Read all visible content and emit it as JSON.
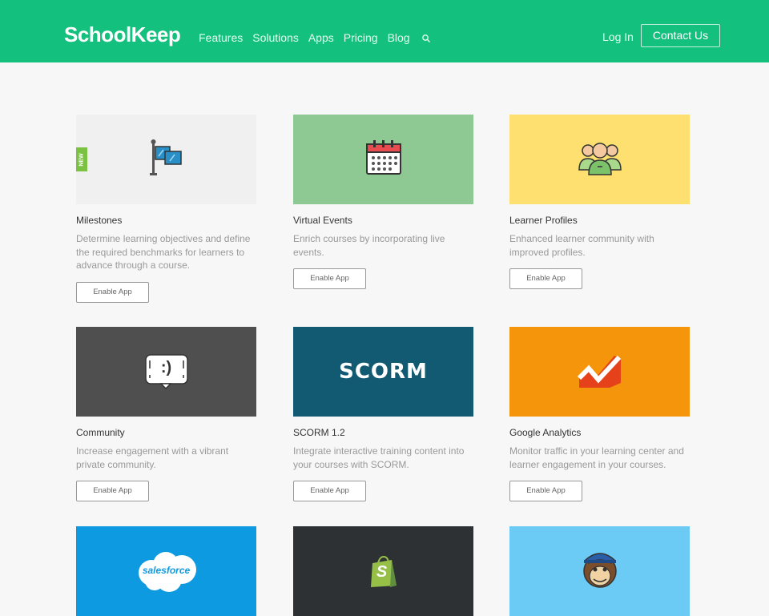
{
  "nav": {
    "logo": "SchoolKeep",
    "links": [
      "Features",
      "Solutions",
      "Apps",
      "Pricing",
      "Blog"
    ],
    "login": "Log In",
    "contact": "Contact Us"
  },
  "new_tag": "NEW",
  "cards": [
    {
      "title": "Milestones",
      "desc": "Determine learning objectives and define the required benchmarks for learners to advance through a course.",
      "button": "Enable App",
      "bg": "#f0f0f0",
      "icon": "flag-icon"
    },
    {
      "title": "Virtual Events",
      "desc": "Enrich courses by incorporating live events.",
      "button": "Enable App",
      "bg": "#8ec993",
      "icon": "calendar-icon"
    },
    {
      "title": "Learner Profiles",
      "desc": "Enhanced learner community with improved profiles.",
      "button": "Enable App",
      "bg": "#fde06f",
      "icon": "people-icon"
    },
    {
      "title": "Community",
      "desc": "Increase engagement with a vibrant private community.",
      "button": "Enable App",
      "bg": "#4f4f4f",
      "icon": "chat-icon",
      "icon_text": ":)"
    },
    {
      "title": "SCORM 1.2",
      "desc": "Integrate interactive training content into your courses with SCORM.",
      "button": "Enable App",
      "bg": "#115a72",
      "icon": "scorm-logo",
      "icon_text": "SCORM"
    },
    {
      "title": "Google Analytics",
      "desc": "Monitor traffic in your learning center and learner engagement in your courses.",
      "button": "Enable App",
      "bg": "#f5950c",
      "icon": "analytics-icon"
    },
    {
      "bg": "#0d9ae0",
      "icon": "salesforce-logo",
      "icon_text": "salesforce"
    },
    {
      "bg": "#2d3133",
      "icon": "shopify-icon",
      "icon_text": "S"
    },
    {
      "bg": "#6bcbf4",
      "icon": "mailchimp-icon"
    }
  ]
}
